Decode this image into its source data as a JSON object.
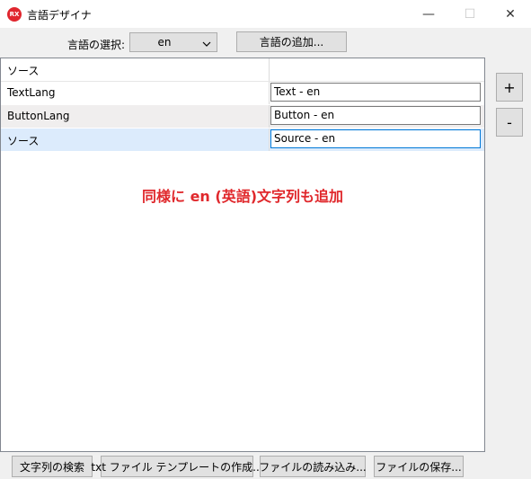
{
  "window": {
    "title": "言語デザイナ",
    "icon_text": "RX",
    "min_glyph": "—",
    "max_glyph": "☐",
    "close_glyph": "✕"
  },
  "toolbar": {
    "language_label": "言語の選択:",
    "language_value": "en",
    "chevron": "⌄",
    "add_language_label": "言語の追加..."
  },
  "grid": {
    "rows": [
      {
        "key": "ソース",
        "value": ""
      },
      {
        "key": "TextLang",
        "value": "Text - en"
      },
      {
        "key": "ButtonLang",
        "value": "Button - en"
      },
      {
        "key": "ソース",
        "value": "Source - en"
      }
    ]
  },
  "annotation": "同様に en (英語)文字列も追加",
  "side_buttons": {
    "add": "+",
    "remove": "-"
  },
  "bottom": {
    "search_label": "文字列の検索",
    "template_label": "txt ファイル テンプレートの作成...",
    "load_label": "ファイルの読み込み...",
    "save_label": "ファイルの保存..."
  },
  "colors": {
    "annotation": "#e0282c",
    "selected_row": "#dcebfc",
    "focus_border": "#0078d7",
    "app_icon": "#e0262e"
  }
}
